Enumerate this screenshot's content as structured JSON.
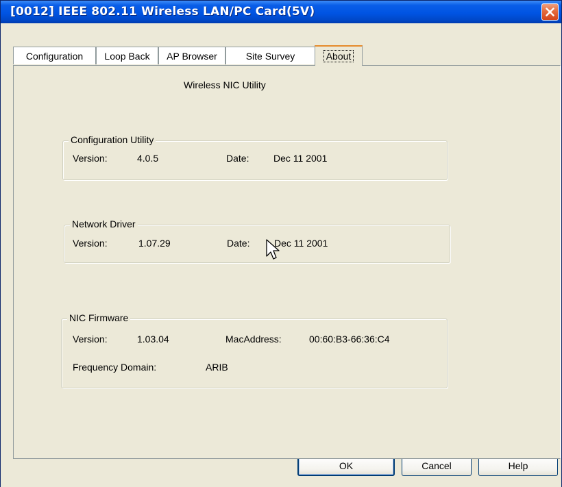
{
  "window": {
    "title": "[0012] IEEE 802.11 Wireless LAN/PC Card(5V)"
  },
  "tabs": [
    {
      "label": "Configuration"
    },
    {
      "label": "Loop Back"
    },
    {
      "label": "AP Browser"
    },
    {
      "label": "Site Survey"
    },
    {
      "label": "About"
    }
  ],
  "about": {
    "heading": "Wireless NIC Utility",
    "config_utility": {
      "legend": "Configuration Utility",
      "version_label": "Version:",
      "version": "4.0.5",
      "date_label": "Date:",
      "date": "Dec 11 2001"
    },
    "network_driver": {
      "legend": "Network Driver",
      "version_label": "Version:",
      "version": "1.07.29",
      "date_label": "Date:",
      "date": "Dec 11 2001"
    },
    "nic_firmware": {
      "legend": "NIC Firmware",
      "version_label": "Version:",
      "version": "1.03.04",
      "mac_label": "MacAddress:",
      "mac": "00:60:B3-66:36:C4",
      "freq_label": "Frequency Domain:",
      "freq": "ARIB"
    }
  },
  "buttons": {
    "ok": "OK",
    "cancel": "Cancel",
    "help": "Help"
  },
  "icons": {
    "close": "close-icon",
    "cursor": "mouse-pointer-icon"
  },
  "colors": {
    "titlebar": "#0054e3",
    "close": "#d4461c",
    "active_tab_accent": "#e68b2c",
    "dialog_bg": "#ece9d8"
  }
}
